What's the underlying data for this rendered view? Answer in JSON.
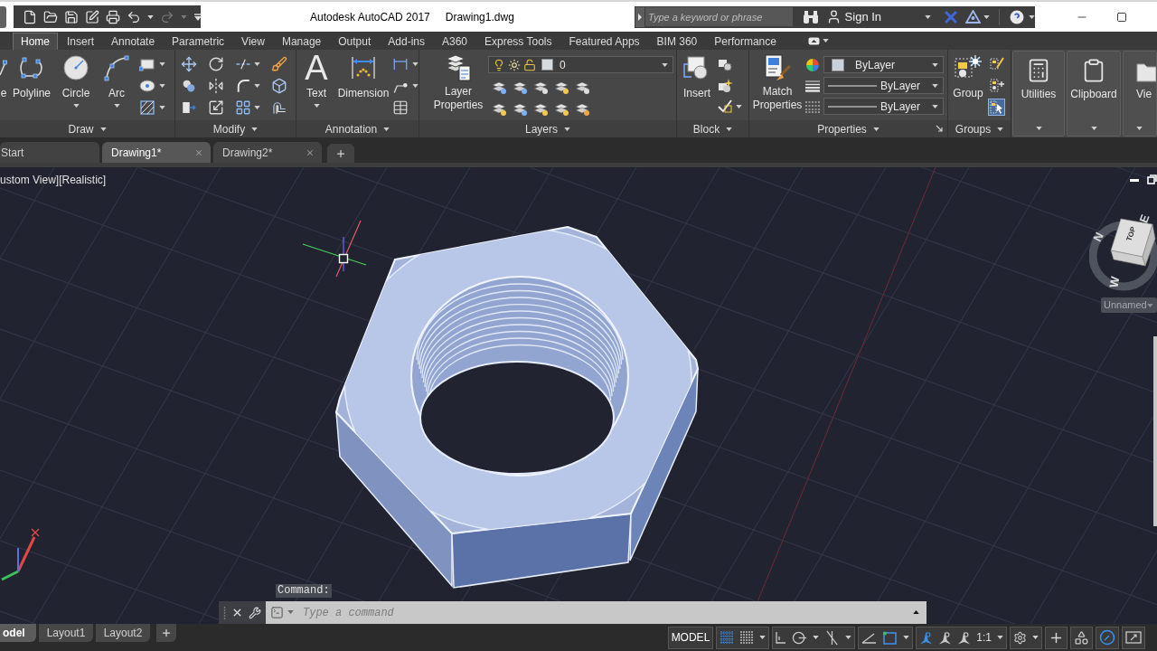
{
  "title_bar": {
    "quick_access": [
      {
        "kind": "new",
        "disabled": false
      },
      {
        "kind": "open",
        "disabled": false
      },
      {
        "kind": "save",
        "disabled": false
      },
      {
        "kind": "save_as",
        "disabled": false
      },
      {
        "kind": "print",
        "disabled": false
      },
      {
        "kind": "undo",
        "disabled": false
      },
      {
        "kind": "redo",
        "disabled": true
      }
    ],
    "app_title": "Autodesk AutoCAD 2017",
    "file_name": "Drawing1.dwg",
    "search": {
      "placeholder": "Type a keyword or phrase"
    },
    "sign_in": "Sign In"
  },
  "ribbon_tabs": [
    {
      "label": "Home",
      "selected": true
    },
    {
      "label": "Insert",
      "selected": false
    },
    {
      "label": "Annotate",
      "selected": false
    },
    {
      "label": "Parametric",
      "selected": false
    },
    {
      "label": "View",
      "selected": false
    },
    {
      "label": "Manage",
      "selected": false
    },
    {
      "label": "Output",
      "selected": false
    },
    {
      "label": "Add-ins",
      "selected": false
    },
    {
      "label": "A360",
      "selected": false
    },
    {
      "label": "Express Tools",
      "selected": false
    },
    {
      "label": "Featured Apps",
      "selected": false
    },
    {
      "label": "BIM 360",
      "selected": false
    },
    {
      "label": "Performance",
      "selected": false
    }
  ],
  "ribbon": {
    "draw": {
      "title": "Draw",
      "buttons": [
        {
          "kind": "line",
          "label": "e"
        },
        {
          "kind": "polyline",
          "label": "Polyline"
        },
        {
          "kind": "circle",
          "label": "Circle"
        },
        {
          "kind": "arc",
          "label": "Arc"
        }
      ]
    },
    "modify": {
      "title": "Modify"
    },
    "annotation": {
      "title": "Annotation",
      "text": {
        "glyph": "A",
        "label": "Text"
      },
      "dimension": "Dimension"
    },
    "layers": {
      "title": "Layers",
      "layer_properties": "Layer Properties",
      "current_layer": "0"
    },
    "block": {
      "title": "Block",
      "insert": "Insert"
    },
    "properties": {
      "title": "Properties",
      "match_properties": "Match Properties",
      "color_setting": "ByLayer",
      "lineweight_setting": "ByLayer",
      "linetype_setting": "ByLayer"
    },
    "groups": {
      "title": "Groups",
      "group": "Group",
      "group_selection_on": true
    },
    "collapsed": [
      {
        "kind": "utilities",
        "label": "Utilities"
      },
      {
        "kind": "clipboard",
        "label": "Clipboard"
      },
      {
        "kind": "view",
        "label": "Vie"
      }
    ]
  },
  "document_tabs": [
    {
      "label": "Start",
      "selected": false
    },
    {
      "label": "Drawing1*",
      "selected": true
    },
    {
      "label": "Drawing2*",
      "selected": false
    }
  ],
  "viewport": {
    "view_label": "ustom View][Realistic]",
    "viewcube": {
      "compass": [
        "N",
        "E",
        "W"
      ],
      "face": "TOP",
      "named_view": "Unnamed"
    },
    "command_history": "Command:",
    "command_line": {
      "placeholder": "Type a command"
    }
  },
  "layout_tabs": [
    {
      "label": "odel",
      "selected": true
    },
    {
      "label": "Layout1",
      "selected": false
    },
    {
      "label": "Layout2",
      "selected": false
    }
  ],
  "status_bar": {
    "groups": [
      [
        {
          "kind": "model",
          "label": "MODEL"
        }
      ],
      [
        {
          "kind": "grid",
          "on": true
        },
        {
          "kind": "snap",
          "on": false
        },
        {
          "kind": "menu"
        }
      ],
      [
        {
          "kind": "ortho",
          "on": false
        },
        {
          "kind": "polar",
          "on": false
        },
        {
          "kind": "menu"
        },
        {
          "kind": "isodraft",
          "on": false
        },
        {
          "kind": "menu"
        }
      ],
      [
        {
          "kind": "dynamic_ucs",
          "on": false
        },
        {
          "kind": "object_snap",
          "on": true
        },
        {
          "kind": "menu"
        }
      ],
      [
        {
          "kind": "annotation_visibility",
          "on": true
        },
        {
          "kind": "auto_scale",
          "on": false
        },
        {
          "kind": "annotation_scale",
          "on": false
        },
        {
          "kind": "scale",
          "label": "1:1"
        },
        {
          "kind": "menu"
        }
      ],
      [
        {
          "kind": "settings"
        },
        {
          "kind": "menu"
        }
      ],
      [
        {
          "kind": "add"
        }
      ],
      [
        {
          "kind": "isolate"
        }
      ],
      [
        {
          "kind": "hardware_acceleration",
          "on": true
        }
      ],
      [
        {
          "kind": "fullscreen"
        }
      ]
    ]
  }
}
